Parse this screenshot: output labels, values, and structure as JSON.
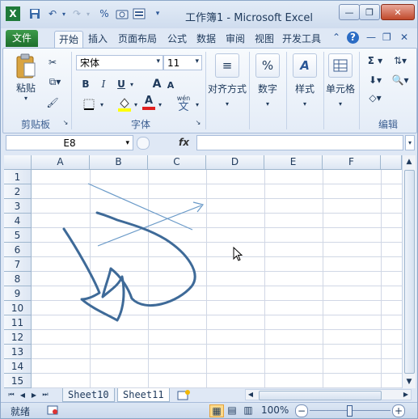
{
  "window": {
    "title": "工作簿1 - Microsoft Excel",
    "controls": [
      "minimize-icon",
      "restore-icon",
      "close-icon"
    ]
  },
  "quick_access": [
    "save-icon",
    "undo-icon",
    "redo-icon",
    "percent-icon",
    "camera-icon",
    "form-icon"
  ],
  "tabs": [
    {
      "label": "文件"
    },
    {
      "label": "开始"
    },
    {
      "label": "插入"
    },
    {
      "label": "页面布局"
    },
    {
      "label": "公式"
    },
    {
      "label": "数据"
    },
    {
      "label": "审阅"
    },
    {
      "label": "视图"
    },
    {
      "label": "开发工具"
    }
  ],
  "ribbon": {
    "clipboard": {
      "paste_label": "粘贴",
      "group_label": "剪贴板"
    },
    "font": {
      "font_name": "宋体",
      "font_size": "11",
      "group_label": "字体",
      "bold": "B",
      "italic": "I",
      "underline": "U",
      "grow": "A",
      "shrink": "A",
      "font_color": "A",
      "phonetic": "wén"
    },
    "alignment": {
      "label": "对齐方式"
    },
    "number": {
      "label": "数字"
    },
    "styles": {
      "label": "样式"
    },
    "cells": {
      "label": "单元格"
    },
    "editing": {
      "group_label": "编辑"
    }
  },
  "formula_bar": {
    "name_box": "E8",
    "fx": "fx",
    "value": ""
  },
  "grid": {
    "columns": [
      "A",
      "B",
      "C",
      "D",
      "E",
      "F"
    ],
    "rows": [
      "1",
      "2",
      "3",
      "4",
      "5",
      "6",
      "7",
      "8",
      "9",
      "10",
      "11",
      "12",
      "13",
      "14",
      "15"
    ]
  },
  "sheets": [
    "Sheet10",
    "Sheet11"
  ],
  "status": {
    "ready": "就绪",
    "zoom": "100%"
  },
  "colors": {
    "excel_green": "#1f7a3a",
    "drawing_stroke": "#3e6a98",
    "arrow_stroke": "#6a9ac8"
  }
}
